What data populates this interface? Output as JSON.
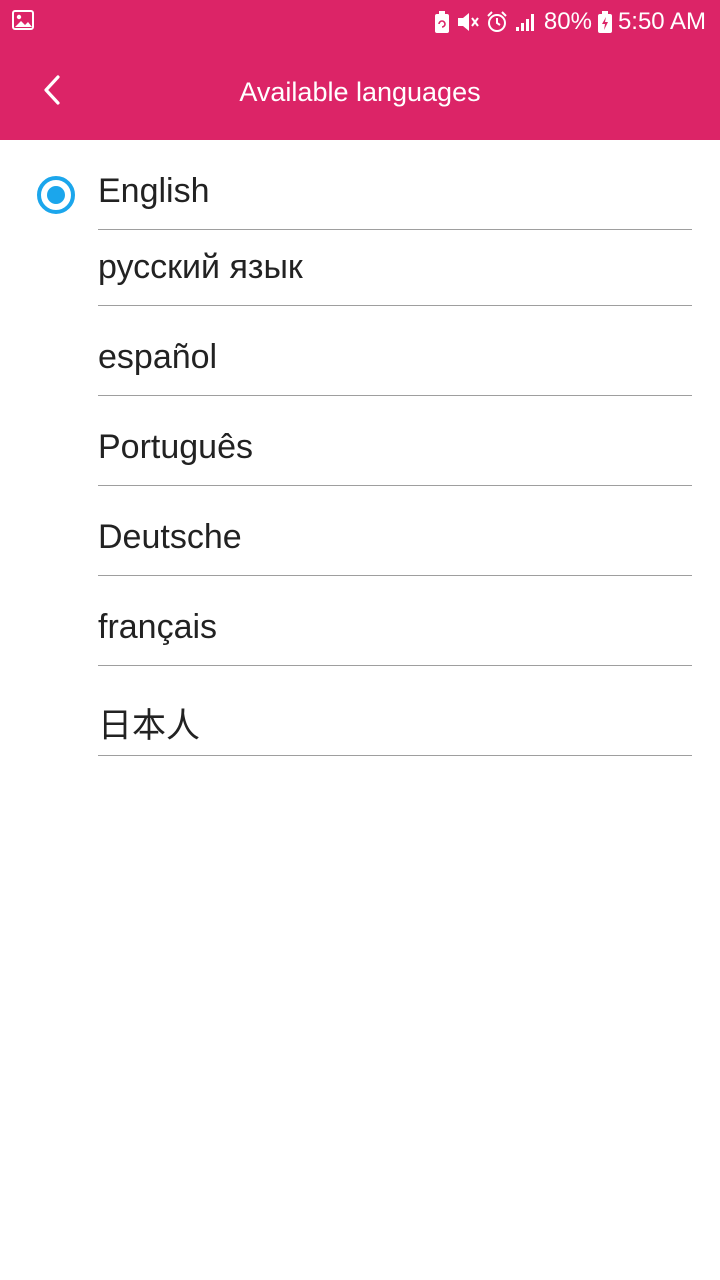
{
  "status_bar": {
    "battery_percent": "80%",
    "time": "5:50 AM",
    "icons": [
      "gallery-icon",
      "battery-saver-icon",
      "mute-icon",
      "alarm-icon",
      "signal-icon",
      "battery-charging-icon"
    ]
  },
  "toolbar": {
    "title": "Available languages",
    "back_icon": "chevron-left-icon"
  },
  "colors": {
    "header": "#DC2467",
    "accent": "#1BA6EC",
    "divider": "#9e9e9e",
    "text": "#222222"
  },
  "languages": {
    "selected": "English",
    "items": [
      {
        "label": "English",
        "selected": true
      },
      {
        "label": "русский язык",
        "selected": false
      },
      {
        "label": "español",
        "selected": false
      },
      {
        "label": "Português",
        "selected": false
      },
      {
        "label": "Deutsche",
        "selected": false
      },
      {
        "label": "français",
        "selected": false
      },
      {
        "label": "日本人",
        "selected": false
      }
    ]
  }
}
